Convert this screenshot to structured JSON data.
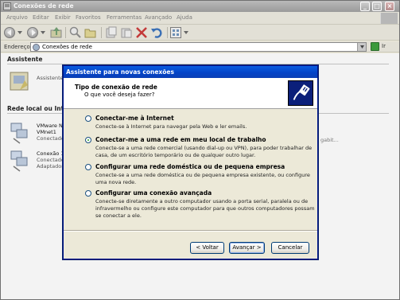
{
  "window": {
    "title": "Conexões de rede"
  },
  "menu": [
    "Arquivo",
    "Editar",
    "Exibir",
    "Favoritos",
    "Ferramentas",
    "Avançado",
    "Ajuda"
  ],
  "address": {
    "label": "Endereço",
    "value": "Conexões de rede",
    "go_label": "Ir"
  },
  "content": {
    "wizard_section": "Assistente",
    "wizard_item": "Assistente",
    "lan_section": "Rede local ou Inter",
    "connections": [
      {
        "line1": "VMware Ne",
        "line2": "VMnet1",
        "line3": "Conectado"
      },
      {
        "line1": "Conexão 1",
        "line2": "Conectado",
        "line3": "Adaptador"
      }
    ],
    "truncated_right": "gabit..."
  },
  "dialog": {
    "title": "Assistente para novas conexões",
    "header_title": "Tipo de conexão de rede",
    "header_subtitle": "O que você deseja fazer?",
    "options": [
      {
        "label": "Conectar-me à Internet",
        "description": "Conecte-se à Internet para navegar pela Web e ler emails.",
        "selected": false
      },
      {
        "label": "Conectar-me a uma rede em meu local de trabalho",
        "description": "Conecte-se a uma rede comercial (usando dial-up ou VPN), para poder trabalhar de casa, de um escritório temporário ou de qualquer outro lugar.",
        "selected": true
      },
      {
        "label": "Configurar uma rede doméstica ou de pequena empresa",
        "description": "Conecte-se a uma rede doméstica ou de pequena empresa existente, ou configure uma nova rede.",
        "selected": false
      },
      {
        "label": "Configurar uma conexão avançada",
        "description": "Conecte-se diretamente a outro computador usando a porta serial, paralela ou de infravermelho ou configure este computador para que outros computadores possam se conectar a ele.",
        "selected": false
      }
    ],
    "buttons": {
      "back": "< Voltar",
      "next": "Avançar >",
      "cancel": "Cancelar"
    }
  },
  "colors": {
    "dialog_title": "#0a5de0",
    "face": "#ece9d8",
    "selected_radio": "#21a121"
  }
}
